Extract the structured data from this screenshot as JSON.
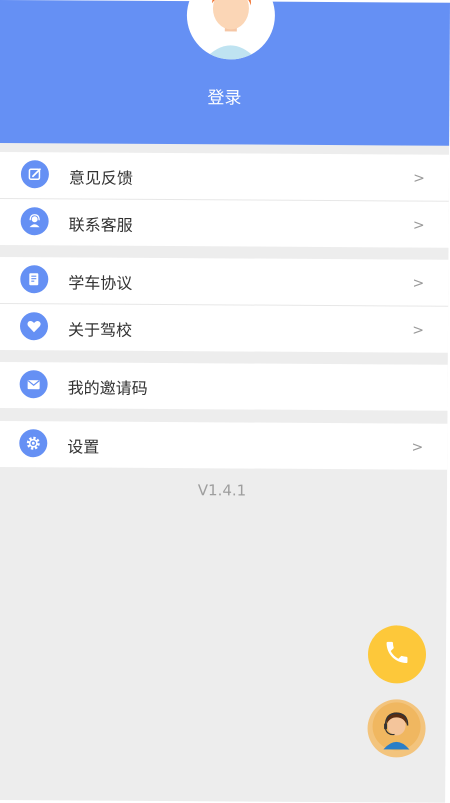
{
  "profile": {
    "login_label": "登录"
  },
  "menu_groups": [
    {
      "items": [
        {
          "label": "意见反馈",
          "icon": "edit-icon",
          "arrow": ">"
        },
        {
          "label": "联系客服",
          "icon": "customer-service-icon",
          "arrow": ">"
        }
      ]
    },
    {
      "items": [
        {
          "label": "学车协议",
          "icon": "contract-icon",
          "arrow": ">"
        },
        {
          "label": "关于驾校",
          "icon": "heart-icon",
          "arrow": ">"
        }
      ]
    },
    {
      "items": [
        {
          "label": "我的邀请码",
          "icon": "mail-icon"
        }
      ]
    },
    {
      "items": [
        {
          "label": "设置",
          "icon": "gear-icon",
          "arrow": ">"
        }
      ]
    }
  ],
  "version": "V1.4.1",
  "floating_buttons": {
    "phone_icon": "phone-icon",
    "service_icon": "service-agent-icon"
  },
  "colors": {
    "accent": "#6590f4",
    "background": "#ededed",
    "phone_button": "#fdc83a",
    "service_button": "#f3c47d"
  }
}
